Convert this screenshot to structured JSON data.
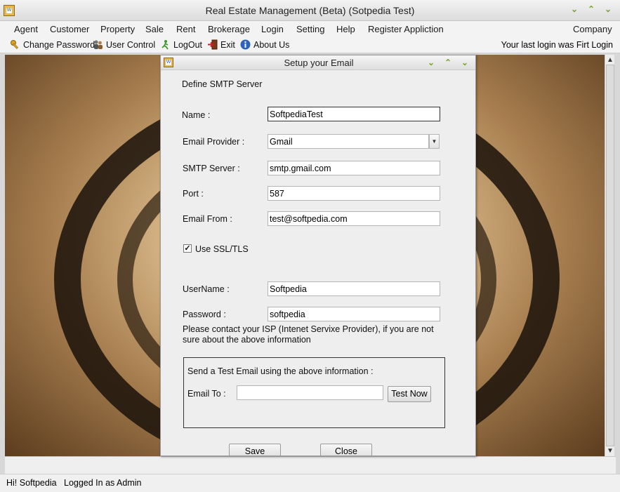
{
  "window": {
    "title": "Real Estate Management (Beta) (Sotpedia Test)",
    "controls": [
      "minimize",
      "restore",
      "close"
    ]
  },
  "menu": {
    "items": [
      "Agent",
      "Customer",
      "Property",
      "Sale",
      "Rent",
      "Brokerage",
      "Login",
      "Setting",
      "Help",
      "Register Appliction"
    ],
    "right_item": "Company"
  },
  "toolbar": {
    "items": [
      {
        "label": "Change Password",
        "icon": "key-icon"
      },
      {
        "label": "User Control",
        "icon": "users-icon"
      },
      {
        "label": "LogOut",
        "icon": "logout-icon"
      },
      {
        "label": "Exit",
        "icon": "exit-icon"
      },
      {
        "label": "About Us",
        "icon": "info-icon"
      }
    ],
    "last_login": "Your last login was Firt Login"
  },
  "dialog": {
    "title": "Setup your Email",
    "section": "Define SMTP Server",
    "name_label": "Name :",
    "name_value": "SoftpediaTest",
    "provider_label": "Email Provider :",
    "provider_value": "Gmail",
    "smtp_label": "SMTP Server :",
    "smtp_value": "smtp.gmail.com",
    "port_label": "Port :",
    "port_value": "587",
    "from_label": "Email From :",
    "from_value": "test@softpedia.com",
    "ssl_label": "Use SSL/TLS",
    "ssl_checked": true,
    "username_label": "UserName :",
    "username_value": "Softpedia",
    "password_label": "Password :",
    "password_value": "softpedia",
    "note": "Please contact your ISP (Intenet Servixe Provider), if you are not sure about the above information",
    "test_group": {
      "title": "Send a Test Email using the above information :",
      "email_to_label": "Email To :",
      "email_to_value": "",
      "test_button": "Test Now"
    },
    "save_button": "Save",
    "close_button": "Close"
  },
  "status": {
    "text": "Hi! Softpedia   Logged In as Admin"
  }
}
